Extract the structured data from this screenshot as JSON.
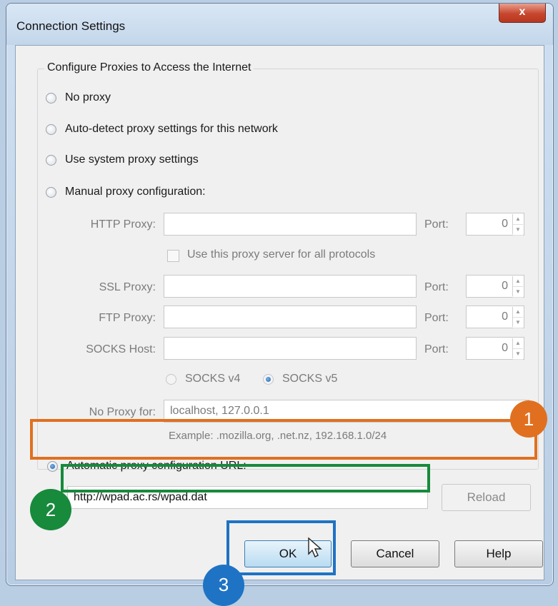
{
  "window": {
    "title": "Connection Settings",
    "close_label": "x"
  },
  "group": {
    "title": "Configure Proxies to Access the Internet"
  },
  "options": {
    "no_proxy": "No proxy",
    "auto_detect": "Auto-detect proxy settings for this network",
    "system": "Use system proxy settings",
    "manual": "Manual proxy configuration:",
    "auto_url": "Automatic proxy configuration URL:"
  },
  "manual": {
    "http_label": "HTTP Proxy:",
    "ssl_label": "SSL Proxy:",
    "ftp_label": "FTP Proxy:",
    "socks_label": "SOCKS Host:",
    "port_label": "Port:",
    "http_port": "0",
    "ssl_port": "0",
    "ftp_port": "0",
    "socks_port": "0",
    "use_all_label": "Use this proxy server for all protocols",
    "socks_v4": "SOCKS v4",
    "socks_v5": "SOCKS v5",
    "no_proxy_label": "No Proxy for:",
    "no_proxy_value": "localhost, 127.0.0.1",
    "example": "Example: .mozilla.org, .net.nz, 192.168.1.0/24"
  },
  "auto": {
    "url_value": "http://wpad.ac.rs/wpad.dat",
    "reload_label": "Reload"
  },
  "buttons": {
    "ok": "OK",
    "cancel": "Cancel",
    "help": "Help"
  },
  "annotations": {
    "one": "1",
    "two": "2",
    "three": "3"
  },
  "colors": {
    "orange": "#e07020",
    "green": "#178a3c",
    "blue": "#1f73c4"
  }
}
